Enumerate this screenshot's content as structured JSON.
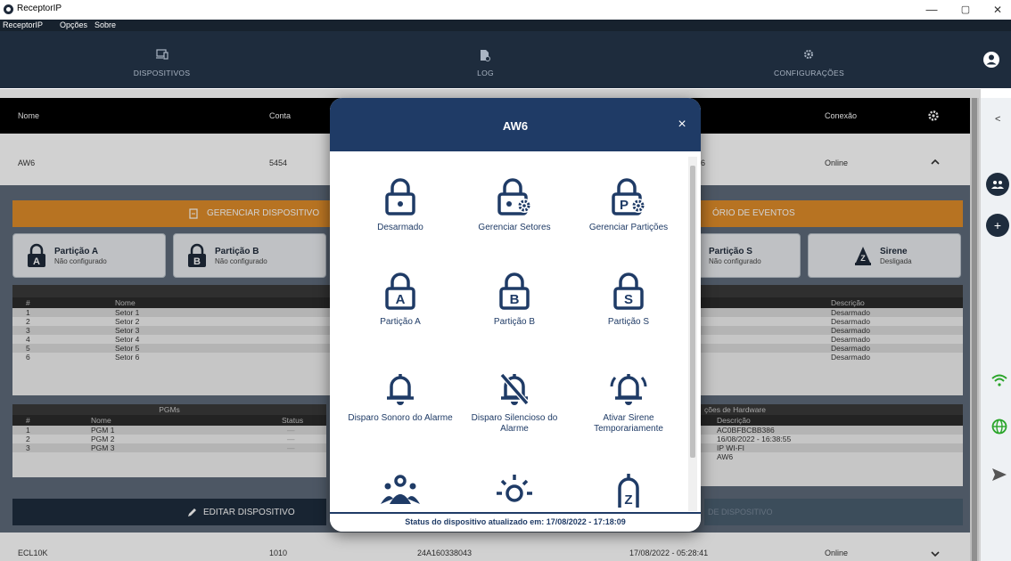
{
  "window": {
    "title": "ReceptorIP",
    "minimize": "—",
    "maximize": "▢",
    "close": "✕"
  },
  "menu": {
    "items": [
      "ReceptorIP",
      "Opções",
      "Sobre"
    ]
  },
  "nav": {
    "tabs": [
      "DISPOSITIVOS",
      "LOG",
      "CONFIGURAÇÕES"
    ]
  },
  "table": {
    "headers": {
      "nome": "Nome",
      "conta": "Conta",
      "conexao": "Conexão"
    },
    "rows": [
      {
        "nome": "AW6",
        "conta": "5454",
        "mac_tail": "6",
        "conexao": "Online"
      },
      {
        "nome": "ECL10K",
        "conta": "1010",
        "mac": "24A160338043",
        "data": "17/08/2022 - 05:28:41",
        "conexao": "Online"
      }
    ]
  },
  "device_panel": {
    "manage_button": "GERENCIAR DISPOSITIVO",
    "events_button": "ÓRIO DE EVENTOS",
    "partitions": [
      {
        "name": "Partição A",
        "status": "Não configurado",
        "letter": "A"
      },
      {
        "name": "Partição B",
        "status": "Não configurado",
        "letter": "B"
      },
      {
        "name": "Partição S",
        "status": "Não configurado",
        "letter": "S"
      }
    ],
    "siren": {
      "name": "Sirene",
      "status": "Desligada"
    },
    "sectors": {
      "headers": {
        "num": "#",
        "nome": "Nome",
        "descricao": "Descrição"
      },
      "rows": [
        {
          "num": "1",
          "nome": "Setor 1",
          "descricao": "Desarmado"
        },
        {
          "num": "2",
          "nome": "Setor 2",
          "descricao": "Desarmado"
        },
        {
          "num": "3",
          "nome": "Setor 3",
          "descricao": "Desarmado"
        },
        {
          "num": "4",
          "nome": "Setor 4",
          "descricao": "Desarmado"
        },
        {
          "num": "5",
          "nome": "Setor 5",
          "descricao": "Desarmado"
        },
        {
          "num": "6",
          "nome": "Setor 6",
          "descricao": "Desarmado"
        }
      ]
    },
    "pgms": {
      "title": "PGMs",
      "headers": {
        "num": "#",
        "nome": "Nome",
        "status": "Status"
      },
      "rows": [
        {
          "num": "1",
          "nome": "PGM 1",
          "status": "—"
        },
        {
          "num": "2",
          "nome": "PGM 2",
          "status": "—"
        },
        {
          "num": "3",
          "nome": "PGM 3",
          "status": "—"
        }
      ]
    },
    "hardware": {
      "title": "ções de Hardware",
      "header": "Descrição",
      "values": [
        "AC0BFBCBB386",
        "16/08/2022 - 16:38:55",
        "IP WI-FI",
        "AW6"
      ]
    },
    "edit_button": "EDITAR DISPOSITIVO",
    "right_button": "DE DISPOSITIVO"
  },
  "side": {
    "collapse": "<",
    "add": "+"
  },
  "modal": {
    "title": "AW6",
    "close": "×",
    "tiles": [
      {
        "label": "Desarmado",
        "icon": "lock-open-icon"
      },
      {
        "label": "Gerenciar Setores",
        "icon": "lock-gear-icon"
      },
      {
        "label": "Gerenciar Partições",
        "icon": "partition-gear-icon"
      },
      {
        "label": "Partição A",
        "icon": "lock-a-icon"
      },
      {
        "label": "Partição B",
        "icon": "lock-b-icon"
      },
      {
        "label": "Partição S",
        "icon": "lock-s-icon"
      },
      {
        "label": "Disparo Sonoro do Alarme",
        "icon": "bell-icon"
      },
      {
        "label": "Disparo Silencioso do Alarme",
        "icon": "bell-off-icon"
      },
      {
        "label": "Ativar Sirene Temporariamente",
        "icon": "bell-ring-icon"
      }
    ],
    "partial_tiles": [
      "users-icon",
      "bulb-icon",
      "siren-z-icon"
    ],
    "status": "Status do dispositivo atualizado em: 17/08/2022 - 17:18:09"
  }
}
